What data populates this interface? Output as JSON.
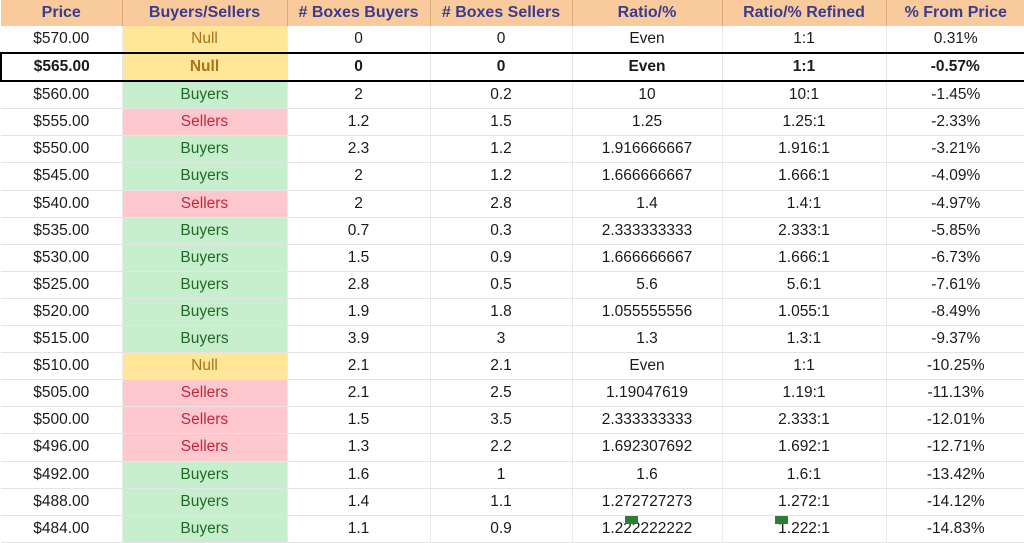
{
  "table": {
    "columns": [
      "Price",
      "Buyers/Sellers",
      "# Boxes Buyers",
      "# Boxes Sellers",
      "Ratio/%",
      "Ratio/% Refined",
      "% From Price"
    ],
    "colors": {
      "header_bg": "#F9CB9C",
      "header_text": "#3B3B8F",
      "buyers_bg": "#C7EFCE",
      "buyers_text": "#1E6A26",
      "sellers_bg": "#FFC7CE",
      "sellers_text": "#C0283C",
      "null_bg": "#FFE699",
      "null_text": "#A8751A",
      "highlight_border": "#000000"
    },
    "highlight_row_index": 1,
    "rows": [
      {
        "price": "$570.00",
        "signal": "Null",
        "signal_kind": "null",
        "boxes_buyers": "0",
        "boxes_sellers": "0",
        "ratio": "Even",
        "ratio_refined": "1:1",
        "pct_from_price": "0.31%",
        "highlighted": false
      },
      {
        "price": "$565.00",
        "signal": "Null",
        "signal_kind": "null",
        "boxes_buyers": "0",
        "boxes_sellers": "0",
        "ratio": "Even",
        "ratio_refined": "1:1",
        "pct_from_price": "-0.57%",
        "highlighted": true
      },
      {
        "price": "$560.00",
        "signal": "Buyers",
        "signal_kind": "buyers",
        "boxes_buyers": "2",
        "boxes_sellers": "0.2",
        "ratio": "10",
        "ratio_refined": "10:1",
        "pct_from_price": "-1.45%",
        "highlighted": false
      },
      {
        "price": "$555.00",
        "signal": "Sellers",
        "signal_kind": "sellers",
        "boxes_buyers": "1.2",
        "boxes_sellers": "1.5",
        "ratio": "1.25",
        "ratio_refined": "1.25:1",
        "pct_from_price": "-2.33%",
        "highlighted": false
      },
      {
        "price": "$550.00",
        "signal": "Buyers",
        "signal_kind": "buyers",
        "boxes_buyers": "2.3",
        "boxes_sellers": "1.2",
        "ratio": "1.916666667",
        "ratio_refined": "1.916:1",
        "pct_from_price": "-3.21%",
        "highlighted": false
      },
      {
        "price": "$545.00",
        "signal": "Buyers",
        "signal_kind": "buyers",
        "boxes_buyers": "2",
        "boxes_sellers": "1.2",
        "ratio": "1.666666667",
        "ratio_refined": "1.666:1",
        "pct_from_price": "-4.09%",
        "highlighted": false
      },
      {
        "price": "$540.00",
        "signal": "Sellers",
        "signal_kind": "sellers",
        "boxes_buyers": "2",
        "boxes_sellers": "2.8",
        "ratio": "1.4",
        "ratio_refined": "1.4:1",
        "pct_from_price": "-4.97%",
        "highlighted": false
      },
      {
        "price": "$535.00",
        "signal": "Buyers",
        "signal_kind": "buyers",
        "boxes_buyers": "0.7",
        "boxes_sellers": "0.3",
        "ratio": "2.333333333",
        "ratio_refined": "2.333:1",
        "pct_from_price": "-5.85%",
        "highlighted": false
      },
      {
        "price": "$530.00",
        "signal": "Buyers",
        "signal_kind": "buyers",
        "boxes_buyers": "1.5",
        "boxes_sellers": "0.9",
        "ratio": "1.666666667",
        "ratio_refined": "1.666:1",
        "pct_from_price": "-6.73%",
        "highlighted": false
      },
      {
        "price": "$525.00",
        "signal": "Buyers",
        "signal_kind": "buyers",
        "boxes_buyers": "2.8",
        "boxes_sellers": "0.5",
        "ratio": "5.6",
        "ratio_refined": "5.6:1",
        "pct_from_price": "-7.61%",
        "highlighted": false
      },
      {
        "price": "$520.00",
        "signal": "Buyers",
        "signal_kind": "buyers",
        "boxes_buyers": "1.9",
        "boxes_sellers": "1.8",
        "ratio": "1.055555556",
        "ratio_refined": "1.055:1",
        "pct_from_price": "-8.49%",
        "highlighted": false
      },
      {
        "price": "$515.00",
        "signal": "Buyers",
        "signal_kind": "buyers",
        "boxes_buyers": "3.9",
        "boxes_sellers": "3",
        "ratio": "1.3",
        "ratio_refined": "1.3:1",
        "pct_from_price": "-9.37%",
        "highlighted": false
      },
      {
        "price": "$510.00",
        "signal": "Null",
        "signal_kind": "null",
        "boxes_buyers": "2.1",
        "boxes_sellers": "2.1",
        "ratio": "Even",
        "ratio_refined": "1:1",
        "pct_from_price": "-10.25%",
        "highlighted": false
      },
      {
        "price": "$505.00",
        "signal": "Sellers",
        "signal_kind": "sellers",
        "boxes_buyers": "2.1",
        "boxes_sellers": "2.5",
        "ratio": "1.19047619",
        "ratio_refined": "1.19:1",
        "pct_from_price": "-11.13%",
        "highlighted": false
      },
      {
        "price": "$500.00",
        "signal": "Sellers",
        "signal_kind": "sellers",
        "boxes_buyers": "1.5",
        "boxes_sellers": "3.5",
        "ratio": "2.333333333",
        "ratio_refined": "2.333:1",
        "pct_from_price": "-12.01%",
        "highlighted": false
      },
      {
        "price": "$496.00",
        "signal": "Sellers",
        "signal_kind": "sellers",
        "boxes_buyers": "1.3",
        "boxes_sellers": "2.2",
        "ratio": "1.692307692",
        "ratio_refined": "1.692:1",
        "pct_from_price": "-12.71%",
        "highlighted": false
      },
      {
        "price": "$492.00",
        "signal": "Buyers",
        "signal_kind": "buyers",
        "boxes_buyers": "1.6",
        "boxes_sellers": "1",
        "ratio": "1.6",
        "ratio_refined": "1.6:1",
        "pct_from_price": "-13.42%",
        "highlighted": false
      },
      {
        "price": "$488.00",
        "signal": "Buyers",
        "signal_kind": "buyers",
        "boxes_buyers": "1.4",
        "boxes_sellers": "1.1",
        "ratio": "1.272727273",
        "ratio_refined": "1.272:1",
        "pct_from_price": "-14.12%",
        "highlighted": false
      },
      {
        "price": "$484.00",
        "signal": "Buyers",
        "signal_kind": "buyers",
        "boxes_buyers": "1.1",
        "boxes_sellers": "0.9",
        "ratio": "1.222222222",
        "ratio_refined": "1.222:1",
        "pct_from_price": "-14.83%",
        "highlighted": false
      }
    ]
  }
}
